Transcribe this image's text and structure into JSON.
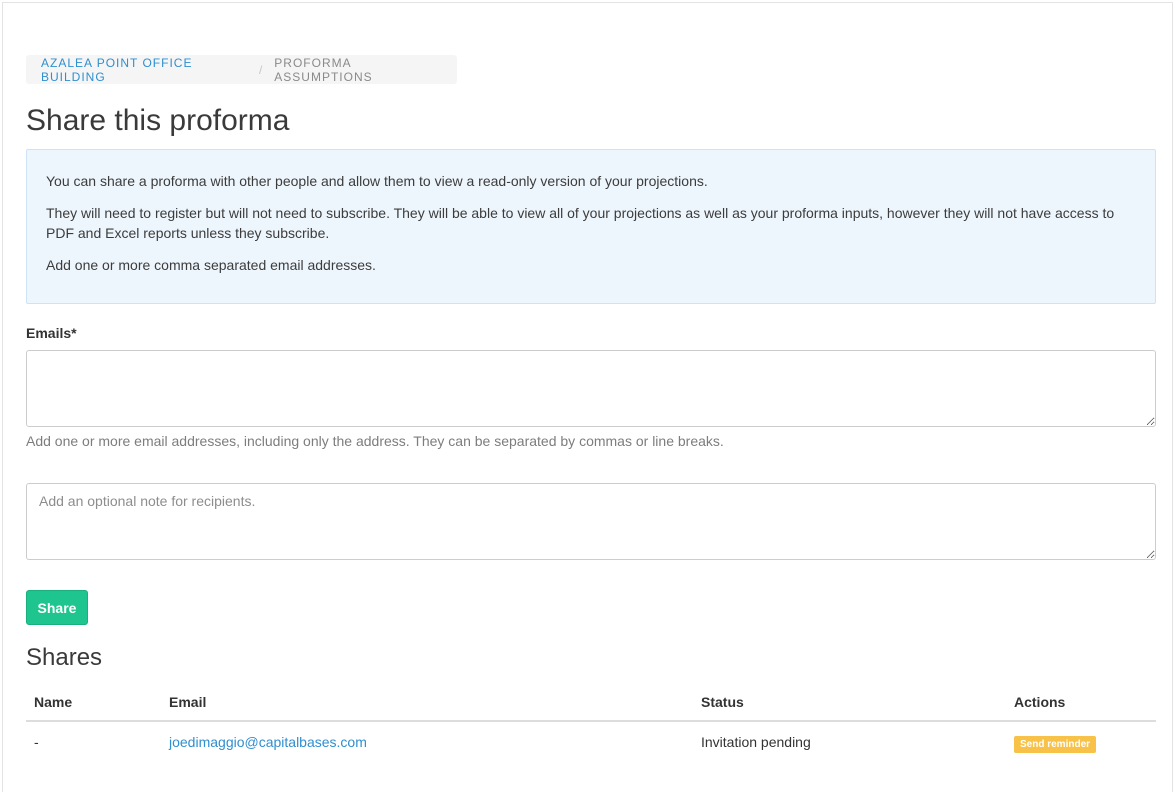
{
  "breadcrumb": {
    "items": [
      "Azalea Point Office Building",
      "Proforma Assumptions"
    ],
    "separator": "/"
  },
  "page": {
    "title": "Share this proforma"
  },
  "info": {
    "p1": "You can share a proforma with other people and allow them to view a read-only version of your projections.",
    "p2": "They will need to register but will not need to subscribe. They will be able to view all of your projections as well as your proforma inputs, however they will not have access to PDF and Excel reports unless they subscribe.",
    "p3": "Add one or more comma separated email addresses."
  },
  "form": {
    "emails_label": "Emails*",
    "emails_value": "",
    "emails_help": "Add one or more email addresses, including only the address. They can be separated by commas or line breaks.",
    "note_value": "",
    "note_placeholder": "Add an optional note for recipients.",
    "share_label": "Share"
  },
  "shares": {
    "title": "Shares",
    "columns": [
      "Name",
      "Email",
      "Status",
      "Actions"
    ],
    "rows": [
      {
        "name": "-",
        "email": "joedimaggio@capitalbases.com",
        "status": "Invitation pending",
        "action": "Send reminder"
      }
    ]
  },
  "colors": {
    "accent": "#2f8fcf",
    "share_button": "#1fc58e",
    "reminder_button": "#f7c247",
    "info_bg": "#eef6fd"
  }
}
